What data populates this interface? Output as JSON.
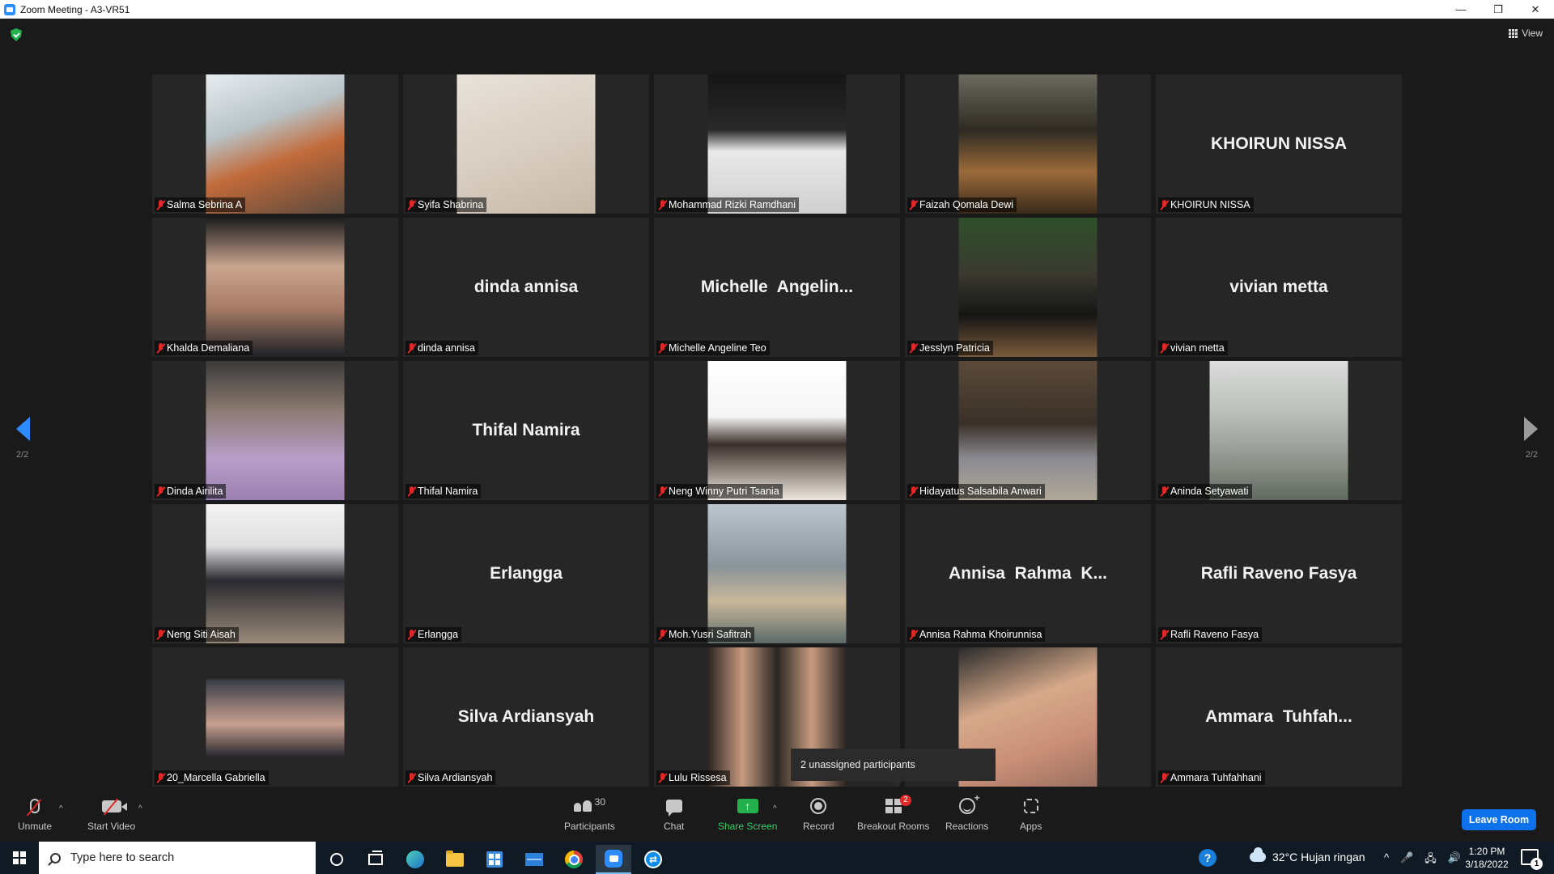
{
  "window": {
    "title": "Zoom Meeting - A3-VR51",
    "minimize_glyph": "—",
    "restore_glyph": "❐",
    "close_glyph": "✕"
  },
  "view": {
    "label": "View"
  },
  "pagination": {
    "left": "2/2",
    "right": "2/2"
  },
  "participants": [
    {
      "display": "",
      "label": "Salma Sebrina A",
      "has_video": true,
      "bg": "linear-gradient(160deg,#e8ecef 0%,#b8c4c8 35%,#c26a3a 60%,#5a4a3e 100%)"
    },
    {
      "display": "",
      "label": "Syifa Shabrina",
      "has_video": true,
      "bg": "linear-gradient(160deg,#e8e2da 0%,#d9cfc3 50%,#c7b9a8 100%)"
    },
    {
      "display": "",
      "label": "Mohammad Rizki Ramdhani",
      "has_video": true,
      "bg": "linear-gradient(180deg,#151515 0%,#2a2a2a 40%,#e9e9e9 55%,#cfcfcf 100%)"
    },
    {
      "display": "",
      "label": "Faizah Qomala Dewi",
      "has_video": true,
      "bg": "linear-gradient(180deg,#6b6b60 0%,#2e2a22 40%,#9b6b3a 70%,#3a2a1a 100%)"
    },
    {
      "display": "KHOIRUN NISSA",
      "label": "KHOIRUN NISSA",
      "has_video": false,
      "bg": ""
    },
    {
      "display": "",
      "label": "Khalda Demaliana",
      "has_video": true,
      "bg": "linear-gradient(180deg,#1c1c1c 0%,#c9a58f 35%,#a87c66 65%,#1e2227 100%)"
    },
    {
      "display": "dinda annisa",
      "label": "dinda annisa",
      "has_video": false,
      "bg": ""
    },
    {
      "display": "Michelle  Angelin...",
      "label": "Michelle Angeline Teo",
      "has_video": false,
      "bg": ""
    },
    {
      "display": "",
      "label": "Jesslyn Patricia",
      "has_video": true,
      "bg": "linear-gradient(180deg,#2f4f2a 0%,#3a3a30 40%,#151515 70%,#7a5a3a 100%)"
    },
    {
      "display": "vivian metta",
      "label": "vivian metta",
      "has_video": false,
      "bg": ""
    },
    {
      "display": "",
      "label": "Dinda Airilita",
      "has_video": true,
      "bg": "linear-gradient(180deg,#3a3a3a 0%,#8a7a70 35%,#b89ec8 70%,#9b80b0 100%)"
    },
    {
      "display": "Thifal Namira",
      "label": "Thifal Namira",
      "has_video": false,
      "bg": ""
    },
    {
      "display": "",
      "label": "Neng Winny Putri Tsania",
      "has_video": true,
      "bg": "linear-gradient(180deg,#ffffff 0%,#f5f5f5 40%,#3a2f2a 60%,#efe8e0 100%)"
    },
    {
      "display": "",
      "label": "Hidayatus Salsabila Anwari",
      "has_video": true,
      "bg": "linear-gradient(180deg,#5a4a3a 0%,#3a3028 45%,#8a8a90 70%,#b0a898 100%)"
    },
    {
      "display": "",
      "label": "Aninda Setyawati",
      "has_video": true,
      "bg": "linear-gradient(180deg,#dcdcdc 0%,#b8bcb8 40%,#8a9088 75%,#606860 100%)"
    },
    {
      "display": "",
      "label": "Neng Siti Aisah",
      "has_video": true,
      "bg": "linear-gradient(180deg,#f2f2f2 0%,#e0e0e0 30%,#2a2a30 55%,#9a8a7a 100%)"
    },
    {
      "display": "Erlangga",
      "label": "Erlangga",
      "has_video": false,
      "bg": ""
    },
    {
      "display": "",
      "label": "Moh.Yusri Safitrah",
      "has_video": true,
      "bg": "linear-gradient(180deg,#bcc6cc 0%,#8a949a 45%,#c9b79a 70%,#5a6a6a 100%)"
    },
    {
      "display": "Annisa  Rahma  K...",
      "label": "Annisa Rahma Khoirunnisa",
      "has_video": false,
      "bg": ""
    },
    {
      "display": "Rafli Raveno Fasya",
      "label": "Rafli Raveno Fasya",
      "has_video": false,
      "bg": ""
    },
    {
      "display": "",
      "label": "20_Marcella Gabriella",
      "has_video": true,
      "bg": "linear-gradient(180deg,#262626 0%,#262626 22%,#3a3f48 24%,#c9a090 55%,#2a2a30 78%,#262626 80%,#262626 100%)"
    },
    {
      "display": "Silva Ardiansyah",
      "label": "Silva Ardiansyah",
      "has_video": false,
      "bg": ""
    },
    {
      "display": "",
      "label": "Lulu Rissesa",
      "has_video": true,
      "bg": "linear-gradient(90deg,#2a2622 0%,#c79b80 25%,#2a2622 50%,#c79b80 75%,#2a2622 100%)"
    },
    {
      "display": "",
      "label": "",
      "has_video": true,
      "bg": "linear-gradient(160deg,#2a2a2a 0%,#d6a98a 40%,#c98f78 70%,#9a7060 100%)"
    },
    {
      "display": "Ammara  Tuhfah...",
      "label": "Ammara Tuhfahhani",
      "has_video": false,
      "bg": ""
    }
  ],
  "popup": {
    "text": "2 unassigned participants"
  },
  "toolbar": {
    "unmute": "Unmute",
    "start_video": "Start Video",
    "participants": "Participants",
    "participants_count": "30",
    "chat": "Chat",
    "share_screen": "Share Screen",
    "record": "Record",
    "breakout_rooms": "Breakout Rooms",
    "breakout_badge": "2",
    "reactions": "Reactions",
    "apps": "Apps",
    "leave": "Leave Room",
    "caret": "^",
    "share_arrow": "↑"
  },
  "taskbar": {
    "search_placeholder": "Type here to search",
    "help": "?",
    "weather": "32°C  Hujan ringan",
    "tray_icons": [
      "^",
      "🎤",
      "🖧",
      "🔊"
    ],
    "time": "1:20 PM",
    "date": "3/18/2022",
    "notification_count": "1",
    "teamviewer_glyph": "⇄"
  },
  "colors": {
    "accent": "#2d8cff",
    "leave": "#0e72ed",
    "muted": "#e02828",
    "share": "#23b14d"
  }
}
